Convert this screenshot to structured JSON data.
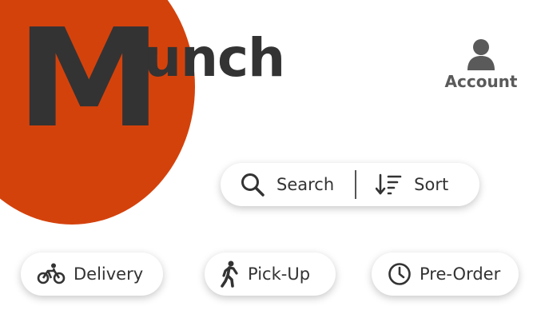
{
  "theme": {
    "accent": "#d4420c",
    "logo_color": "#333333",
    "text_color": "#333333"
  },
  "logo": {
    "initial": "M",
    "rest": "unch"
  },
  "account": {
    "icon": "user-icon",
    "label": "Account"
  },
  "search_bar": {
    "search": {
      "icon": "search-icon",
      "label": "Search"
    },
    "sort": {
      "icon": "sort-icon",
      "label": "Sort"
    }
  },
  "order_modes": [
    {
      "icon": "bicycle-icon",
      "label": "Delivery"
    },
    {
      "icon": "walking-icon",
      "label": "Pick-Up"
    },
    {
      "icon": "clock-icon",
      "label": "Pre-Order"
    }
  ]
}
